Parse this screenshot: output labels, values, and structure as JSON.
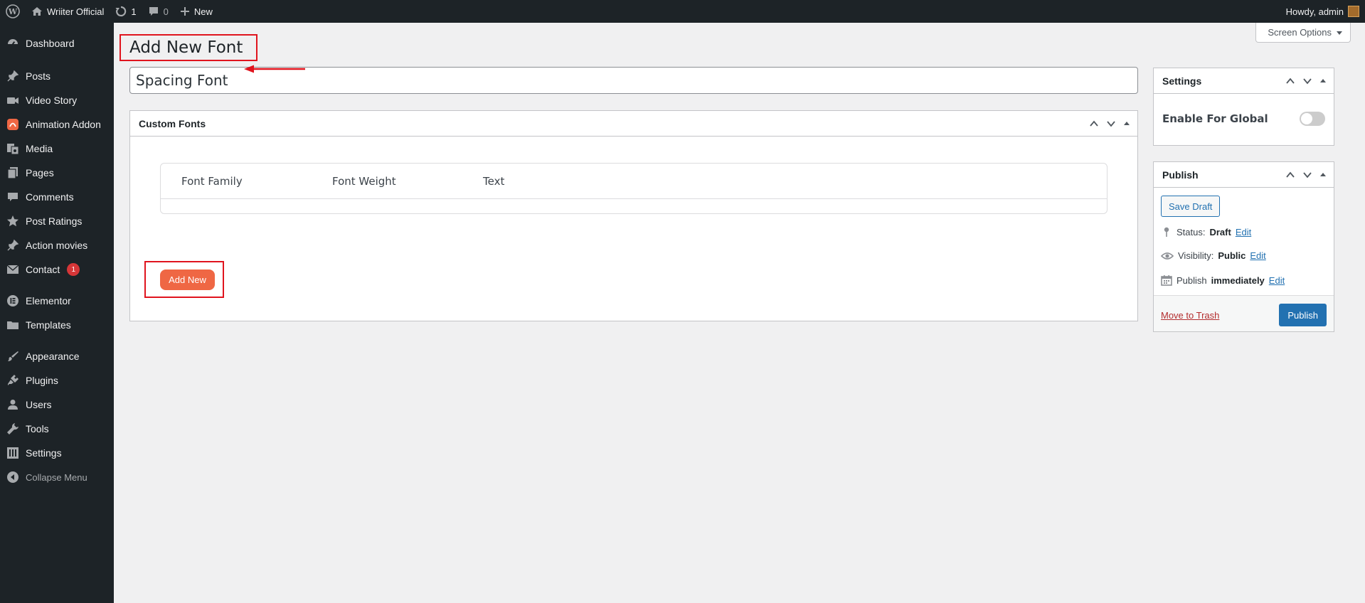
{
  "admin_bar": {
    "site_name": "Wriiter Official",
    "updates_count": "1",
    "comments_count": "0",
    "new_label": "New",
    "howdy": "Howdy, admin"
  },
  "sidebar": {
    "items": [
      {
        "label": "Dashboard",
        "icon": "dashboard-icon"
      },
      {
        "label": "Posts",
        "icon": "pin-icon"
      },
      {
        "label": "Video Story",
        "icon": "video-icon"
      },
      {
        "label": "Animation Addon",
        "icon": "animation-addon-icon"
      },
      {
        "label": "Media",
        "icon": "media-icon"
      },
      {
        "label": "Pages",
        "icon": "pages-icon"
      },
      {
        "label": "Comments",
        "icon": "comments-icon"
      },
      {
        "label": "Post Ratings",
        "icon": "star-icon"
      },
      {
        "label": "Action movies",
        "icon": "pin-icon"
      },
      {
        "label": "Contact",
        "icon": "mail-icon",
        "badge": "1"
      },
      {
        "label": "Elementor",
        "icon": "elementor-icon"
      },
      {
        "label": "Templates",
        "icon": "folder-icon"
      },
      {
        "label": "Appearance",
        "icon": "brush-icon"
      },
      {
        "label": "Plugins",
        "icon": "plugin-icon"
      },
      {
        "label": "Users",
        "icon": "user-icon"
      },
      {
        "label": "Tools",
        "icon": "wrench-icon"
      },
      {
        "label": "Settings",
        "icon": "settings-icon"
      }
    ],
    "collapse_label": "Collapse Menu"
  },
  "screen_options": "Screen Options",
  "page_title": "Add New Font",
  "title_input_value": "Spacing Font",
  "custom_fonts": {
    "title": "Custom Fonts",
    "columns": [
      "Font Family",
      "Font Weight",
      "Text"
    ],
    "add_new_label": "Add New"
  },
  "settings_box": {
    "title": "Settings",
    "toggle_label": "Enable For Global",
    "toggle_on": false
  },
  "publish_box": {
    "title": "Publish",
    "save_draft": "Save Draft",
    "status_label": "Status:",
    "status_value": "Draft",
    "visibility_label": "Visibility:",
    "visibility_value": "Public",
    "publish_label": "Publish",
    "publish_when": "immediately",
    "edit_label": "Edit",
    "move_to_trash": "Move to Trash",
    "publish_button": "Publish"
  },
  "colors": {
    "highlight": "#e0141e",
    "add_new_button": "#ef6744",
    "primary": "#2271b1"
  }
}
